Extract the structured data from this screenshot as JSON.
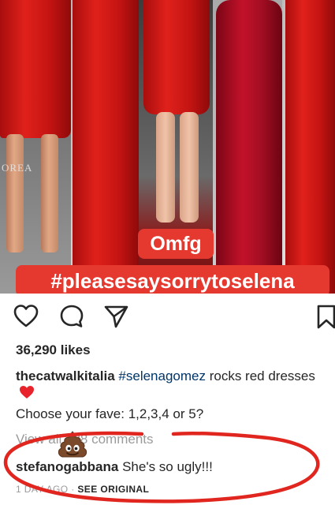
{
  "photo": {
    "sticker_top": "Omfg",
    "sticker_bottom": "#pleasesaysorrytoselena",
    "background_logo": "OREA"
  },
  "actions": {
    "icons": [
      "heart-icon",
      "comment-icon",
      "share-icon",
      "bookmark-icon"
    ]
  },
  "post": {
    "likes": "36,290 likes",
    "caption_user": "thecatwalkitalia",
    "caption_tag": "#selenagomez",
    "caption_text": " rocks red dresses",
    "caption_line2": "Choose your fave: 1,2,3,4 or 5?",
    "view_all": "View all 288 comments"
  },
  "comment": {
    "user": "stefanogabbana",
    "text": " She's so ugly!!!",
    "time": "1 DAY AGO",
    "separator": " · ",
    "see_original": "SEE ORIGINAL"
  },
  "colors": {
    "sticker": "#e5382f",
    "hashtag_link": "#003569",
    "annotation": "#e0261f",
    "muted_text": "#9b9b9b"
  }
}
